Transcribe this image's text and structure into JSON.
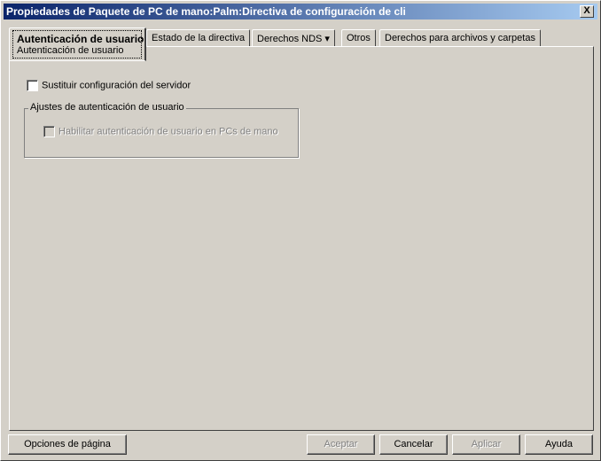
{
  "window": {
    "title": "Propiedades de Paquete de PC de mano:Palm:Directiva de configuración de cli",
    "close": "X"
  },
  "tabs": [
    {
      "label": "Autenticación de usuario",
      "sublabel": "Autenticación de usuario"
    },
    {
      "label": "Estado de la directiva"
    },
    {
      "label": "Derechos NDS ▾"
    },
    {
      "label": "Otros"
    },
    {
      "label": "Derechos para archivos y carpetas"
    }
  ],
  "panel": {
    "override_label": "Sustituir configuración del servidor",
    "group_label": "Ajustes de autenticación de usuario",
    "enable_label": "Habilitar autenticación de usuario en PCs de mano"
  },
  "buttons": {
    "page_options": "Opciones de página",
    "accept": "Aceptar",
    "cancel": "Cancelar",
    "apply": "Aplicar",
    "help": "Ayuda"
  }
}
